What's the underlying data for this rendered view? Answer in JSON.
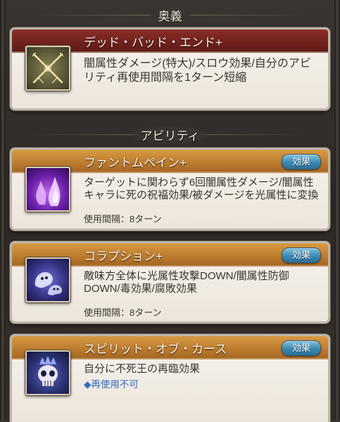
{
  "sections": {
    "ougi_header": "奥義",
    "ability_header": "アビリティ"
  },
  "ougi": {
    "name": "デッド・バッド・エンド+",
    "description": "闇属性ダメージ(特大)/スロウ効果/自分のアビリティ再使用間隔を1ターン短縮",
    "icon": "crossed-swords-icon"
  },
  "abilities": [
    {
      "name": "ファントムペイン+",
      "description": "ターゲットに関わらず6回闇属性ダメージ/闇属性キャラに死の祝福効果/被ダメージを光属性に変換",
      "cooldown": "使用間隔：8ターン",
      "effect_label": "効果",
      "icon": "purple-flame-icon"
    },
    {
      "name": "コラプション+",
      "description": "敵味方全体に光属性攻撃DOWN/闇属性防御DOWN/毒効果/腐敗効果",
      "cooldown": "使用間隔：8ターン",
      "effect_label": "効果",
      "icon": "ghost-icon"
    },
    {
      "name": "スピリット・オブ・カース",
      "description": "自分に不死王の再臨効果",
      "status": "◆再使用不可",
      "effect_label": "効果",
      "icon": "skull-crown-icon"
    }
  ],
  "colors": {
    "ougi_band": "#7a2621",
    "ability_band": "#c4842f",
    "effect_button": "#3d89b1",
    "unusable_text": "#2f6bc4"
  }
}
